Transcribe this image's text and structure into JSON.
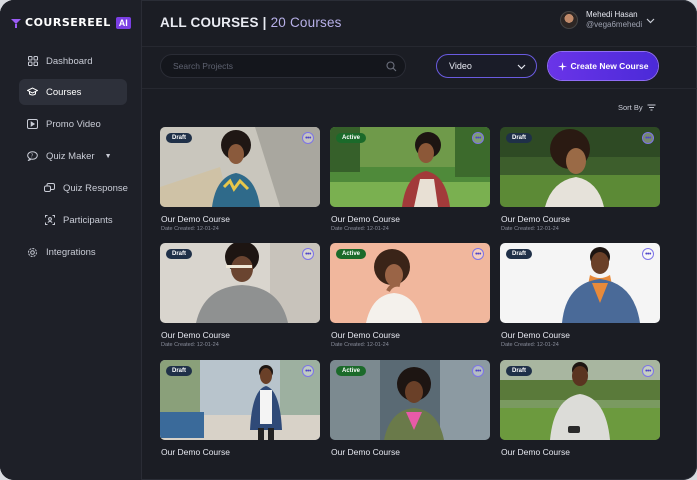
{
  "app": {
    "logo_text": "COURSEREEL",
    "logo_badge": "AI"
  },
  "sidebar": {
    "items": [
      {
        "label": "Dashboard",
        "icon": "grid-icon"
      },
      {
        "label": "Courses",
        "icon": "graduation-cap-icon",
        "active": true
      },
      {
        "label": "Promo Video",
        "icon": "play-icon"
      },
      {
        "label": "Quiz Maker",
        "icon": "quiz-icon",
        "has_caret": true
      },
      {
        "label": "Quiz Response",
        "icon": "response-icon",
        "sub": true
      },
      {
        "label": "Participants",
        "icon": "participants-icon",
        "sub": true
      },
      {
        "label": "Integrations",
        "icon": "gear-icon"
      }
    ]
  },
  "header": {
    "title": "ALL COURSES |",
    "count": "20 Courses"
  },
  "user": {
    "name": "Mehedi Hasan",
    "handle": "@vega6mehedi"
  },
  "toolbar": {
    "search_placeholder": "Search Projects",
    "select_value": "Video",
    "create_label": "Create New Course",
    "sort_label": "Sort By"
  },
  "courses": [
    {
      "status": "Draft",
      "title": "Our Demo Course",
      "date": "Date Created: 12-01-24"
    },
    {
      "status": "Active",
      "title": "Our Demo Course",
      "date": "Date Created: 12-01-24"
    },
    {
      "status": "Draft",
      "title": "Our Demo Course",
      "date": "Date Created: 12-01-24"
    },
    {
      "status": "Draft",
      "title": "Our Demo Course",
      "date": "Date Created: 12-01-24"
    },
    {
      "status": "Active",
      "title": "Our Demo Course",
      "date": "Date Created: 12-01-24"
    },
    {
      "status": "Draft",
      "title": "Our Demo Course",
      "date": "Date Created: 12-01-24"
    },
    {
      "status": "Draft",
      "title": "Our Demo Course",
      "date": ""
    },
    {
      "status": "Active",
      "title": "Our Demo Course",
      "date": ""
    },
    {
      "status": "Draft",
      "title": "Our Demo Course",
      "date": ""
    }
  ],
  "colors": {
    "accent": "#6a34e8",
    "active_badge": "#1b6a2a",
    "draft_badge": "#1f3048"
  }
}
